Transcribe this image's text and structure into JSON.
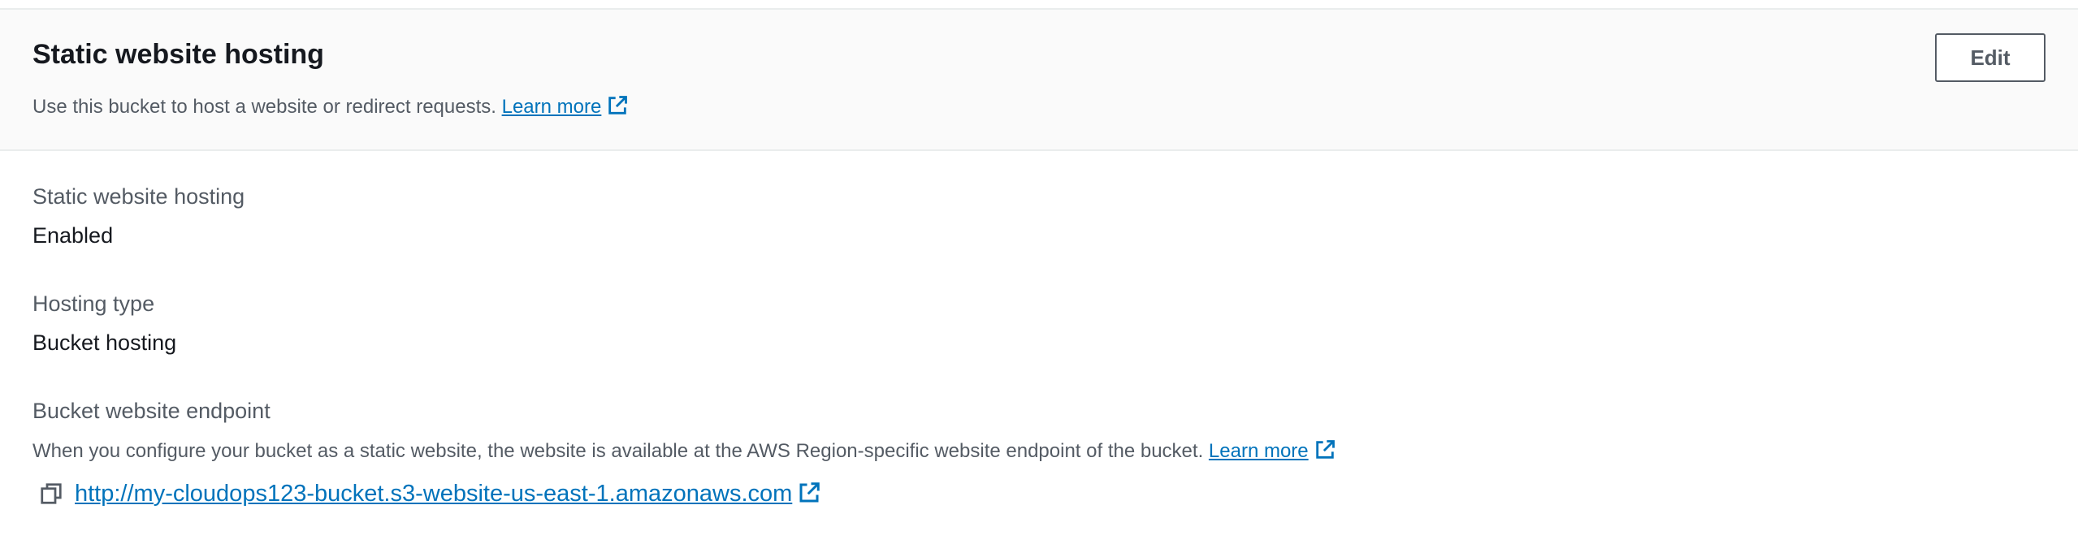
{
  "header": {
    "title": "Static website hosting",
    "description": "Use this bucket to host a website or redirect requests.",
    "learn_more_label": "Learn more",
    "edit_label": "Edit"
  },
  "fields": {
    "hosting_status": {
      "label": "Static website hosting",
      "value": "Enabled"
    },
    "hosting_type": {
      "label": "Hosting type",
      "value": "Bucket hosting"
    },
    "endpoint": {
      "label": "Bucket website endpoint",
      "description": "When you configure your bucket as a static website, the website is available at the AWS Region-specific website endpoint of the bucket.",
      "learn_more_label": "Learn more",
      "url": "http://my-cloudops123-bucket.s3-website-us-east-1.amazonaws.com"
    }
  },
  "icons": {
    "external_link": "external-link-icon",
    "copy": "copy-icon"
  },
  "colors": {
    "link": "#0073bb",
    "header_background": "#fafafa",
    "label_text": "#545b64",
    "body_text": "#16191f"
  }
}
